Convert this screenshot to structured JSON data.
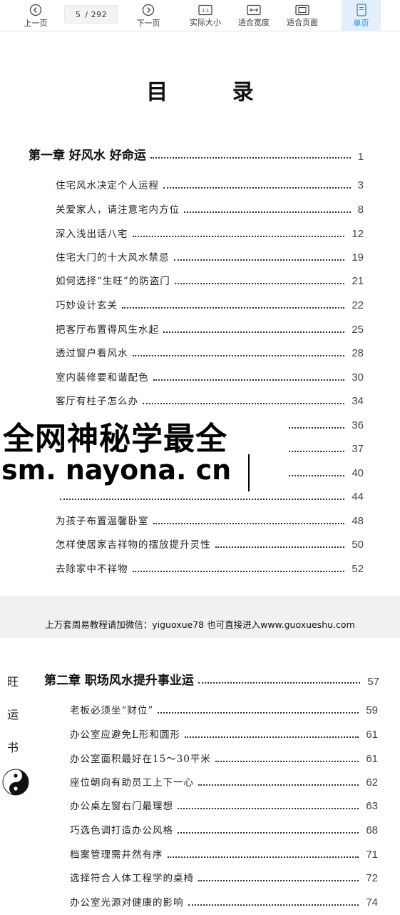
{
  "toolbar": {
    "prev_label": "上一页",
    "next_label": "下一页",
    "current_page": "5",
    "total_pages": "/ 292",
    "actual_size_label": "实际大小",
    "fit_width_label": "适合宽度",
    "fit_page_label": "适合页面",
    "single_page_label": "单页",
    "actual_size_icon_text": "1:1"
  },
  "page1": {
    "title": "目  录",
    "chapter": {
      "title": "第一章   好风水  好命运",
      "page": "1"
    },
    "entries": [
      {
        "title": "住宅风水决定个人运程",
        "page": "3"
      },
      {
        "title": "关爱家人，请注意宅内方位",
        "page": "8"
      },
      {
        "title": "深入浅出话八宅",
        "page": "12"
      },
      {
        "title": "住宅大门的十大风水禁忌",
        "page": "19"
      },
      {
        "title": "如何选择“生旺”的防盗门",
        "page": "21"
      },
      {
        "title": "巧妙设计玄关",
        "page": "22"
      },
      {
        "title": "把客厅布置得风生水起",
        "page": "25"
      },
      {
        "title": "透过窗户看风水",
        "page": "28"
      },
      {
        "title": "室内装修要和谐配色",
        "page": "30"
      },
      {
        "title": "客厅有柱子怎么办",
        "page": "34"
      },
      {
        "title": "",
        "page": "36"
      },
      {
        "title": "",
        "page": "37"
      },
      {
        "title": "",
        "page": "40"
      },
      {
        "title": "",
        "page": "44"
      },
      {
        "title": "为孩子布置温馨卧室",
        "page": "48"
      },
      {
        "title": "怎样使居家吉祥物的摆放提升灵性",
        "page": "50"
      },
      {
        "title": "去除家中不祥物",
        "page": "52"
      }
    ]
  },
  "watermark": {
    "line1": "全网神秘学最全",
    "line2": "sm. nayona. cn"
  },
  "ad_text": "上万套周易教程请加微信：yiguoxue78  也可直接进入www.guoxueshu.com",
  "page2": {
    "side_chars": [
      "旺",
      "运",
      "书"
    ],
    "chapter": {
      "title": "第二章   职场风水提升事业运",
      "page": "57"
    },
    "entries": [
      {
        "title": "老板必须坐“财位”",
        "page": "59"
      },
      {
        "title": "办公室应避免L形和圆形",
        "page": "61"
      },
      {
        "title": "办公室面积最好在15～30平米",
        "page": "61"
      },
      {
        "title": "座位朝向有助员工上下一心",
        "page": "62"
      },
      {
        "title": "办公桌左窗右门最理想",
        "page": "63"
      },
      {
        "title": "巧选色调打造办公风格",
        "page": "68"
      },
      {
        "title": "档案管理需井然有序",
        "page": "71"
      },
      {
        "title": "选择符合人体工程学的桌椅",
        "page": "72"
      },
      {
        "title": "办公室光源对健康的影响",
        "page": "74"
      }
    ]
  },
  "colors": {
    "active_button_bg": "#e3f0fb",
    "active_button_fg": "#2d87d8"
  }
}
